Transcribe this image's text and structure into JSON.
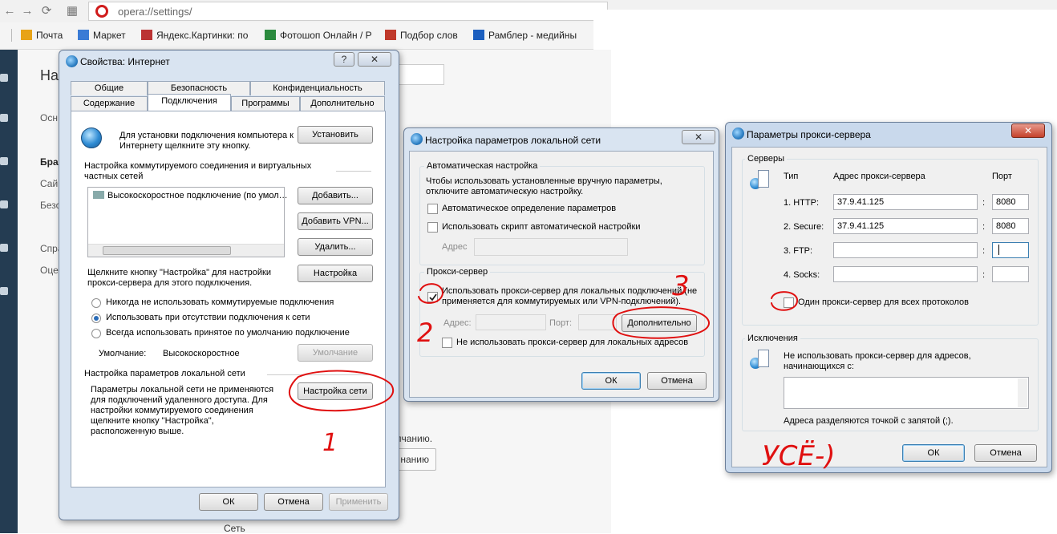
{
  "browser": {
    "back_icon": "←",
    "forward_icon": "→",
    "reload_icon": "⟳",
    "apps_icon": "▦",
    "address": "opera://settings/",
    "bookmarks": [
      {
        "label": "Почта",
        "color": "#e8a317"
      },
      {
        "label": "Маркет",
        "color": "#3a7bd5"
      },
      {
        "label": "Яндекс.Картинки: по",
        "color": "#b33"
      },
      {
        "label": "Фотошоп Онлайн / Р",
        "color": "#2b8a3e"
      },
      {
        "label": "Подбор слов",
        "color": "#c0392b"
      },
      {
        "label": "Рамблер - медийны",
        "color": "#1c5fbf"
      }
    ]
  },
  "settings_page": {
    "heading": "На",
    "items": [
      "Осн",
      "Бра",
      "Сай",
      "Безо",
      "Спра",
      "Оце"
    ],
    "frag_text": "пчанию.",
    "frag_button": "нанию",
    "frag_bottom": "Сеть"
  },
  "internet_props": {
    "title": "Свойства: Интернет",
    "help": "?",
    "close": "✕",
    "tabs_row1": [
      "Общие",
      "Безопасность",
      "Конфиденциальность"
    ],
    "tabs_row2": [
      "Содержание",
      "Подключения",
      "Программы",
      "Дополнительно"
    ],
    "setup_text": "Для установки подключения компьютера к Интернету щелкните эту кнопку.",
    "setup_button": "Установить",
    "dialup_title": "Настройка коммутируемого соединения и виртуальных частных сетей",
    "dialup_item": "Высокоскоростное подключение (по умол…",
    "add_button": "Добавить...",
    "add_vpn_button": "Добавить VPN...",
    "delete_button": "Удалить...",
    "settings_hint": "Щелкните кнопку \"Настройка\" для настройки прокси-сервера для этого подключения.",
    "settings_button": "Настройка",
    "radio_never": "Никогда не использовать коммутируемые подключения",
    "radio_absent": "Использовать при отсутствии подключения к сети",
    "radio_always": "Всегда использовать принятое по умолчанию подключение",
    "default_label": "Умолчание:",
    "default_value": "Высокоскоростное",
    "default_button": "Умолчание",
    "lan_title": "Настройка параметров локальной сети",
    "lan_text": "Параметры локальной сети не применяются для подключений удаленного доступа. Для настройки коммутируемого соединения щелкните кнопку \"Настройка\", расположенную выше.",
    "lan_button": "Настройка сети",
    "ok": "ОК",
    "cancel": "Отмена",
    "apply": "Применить"
  },
  "lan_dialog": {
    "title": "Настройка параметров локальной сети",
    "close": "✕",
    "auto_group": "Автоматическая настройка",
    "auto_text": "Чтобы использовать установленные вручную параметры, отключите автоматическую настройку.",
    "auto_detect": "Автоматическое определение параметров",
    "use_script": "Использовать скрипт автоматической настройки",
    "address_label": "Адрес",
    "proxy_group": "Прокси-сервер",
    "use_proxy": "Использовать прокси-сервер для локальных подключений (не применяется для коммутируемых или VPN-подключений).",
    "addr_label": "Адрес:",
    "port_label": "Порт:",
    "advanced_button": "Дополнительно",
    "bypass_local": "Не использовать прокси-сервер для локальных адресов",
    "ok": "ОК",
    "cancel": "Отмена"
  },
  "proxy_dialog": {
    "title": "Параметры прокси-сервера",
    "close": "✕",
    "servers_group": "Серверы",
    "col_type": "Тип",
    "col_address": "Адрес прокси-сервера",
    "col_port": "Порт",
    "rows": [
      {
        "type": "1. HTTP:",
        "address": "37.9.41.125",
        "port": "8080"
      },
      {
        "type": "2. Secure:",
        "address": "37.9.41.125",
        "port": "8080"
      },
      {
        "type": "3. FTP:",
        "address": "",
        "port": ""
      },
      {
        "type": "4. Socks:",
        "address": "",
        "port": ""
      }
    ],
    "same_proxy": "Один прокси-сервер для всех протоколов",
    "exceptions_group": "Исключения",
    "exceptions_text": "Не использовать прокси-сервер для адресов, начинающихся с:",
    "exceptions_hint": "Адреса разделяются точкой с запятой (;).",
    "ok": "ОК",
    "cancel": "Отмена"
  },
  "annotations": {
    "ink_color": "#e01010",
    "n1": "1",
    "n2": "2",
    "n3": "3",
    "handwriting": "УСЁ-)"
  }
}
